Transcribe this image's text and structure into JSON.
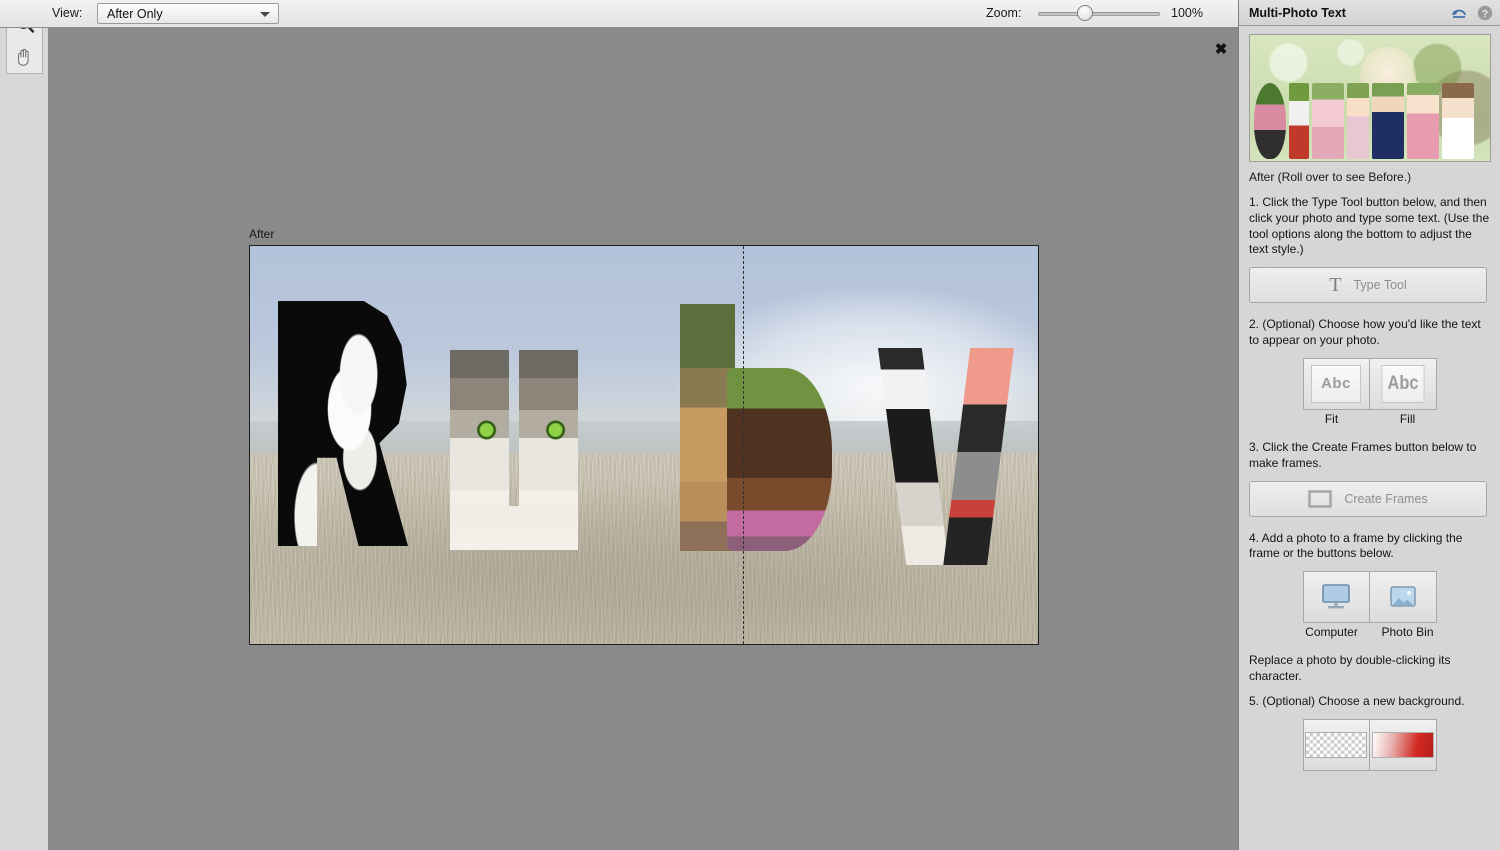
{
  "toolbar": {
    "view_label": "View:",
    "view_value": "After Only",
    "zoom_label": "Zoom:",
    "zoom_value": "100%",
    "zoom_percent": 100,
    "tools": [
      {
        "name": "zoom-tool",
        "icon": "magnifier-icon"
      },
      {
        "name": "hand-tool",
        "icon": "hand-icon"
      }
    ]
  },
  "canvas": {
    "after_label": "After",
    "close_label": "✖",
    "text_content": "RUbV",
    "letters": [
      {
        "char": "R",
        "subject": "tuxedo cat"
      },
      {
        "char": "U",
        "subject": "tabby cat"
      },
      {
        "char": "b",
        "subject": "tan and chocolate dogs"
      },
      {
        "char": "V",
        "subject": "black dogs"
      }
    ],
    "background_subject": "sky over dry grass field"
  },
  "panel": {
    "title": "Multi-Photo Text",
    "header_icons": [
      {
        "name": "reset-icon",
        "label": "↩"
      },
      {
        "name": "help-icon",
        "label": "?"
      }
    ],
    "preview_caption": "After (Roll over to see Before.)",
    "preview_text": "OLIVIA",
    "step1": "1. Click the Type Tool button below, and then click your photo and type some text. (Use the tool options along the bottom to adjust the text style.)",
    "type_tool_button": "Type Tool",
    "type_tool_icon": "T",
    "step2": "2. (Optional) Choose how you'd like the text to appear on your photo.",
    "fit_label": "Fit",
    "fill_label": "Fill",
    "abc_sample": "Abc",
    "step3": "3. Click the Create Frames button below to make frames.",
    "create_frames_button": "Create Frames",
    "step4": "4. Add a photo to a frame by clicking the frame or the buttons below.",
    "computer_label": "Computer",
    "photo_bin_label": "Photo Bin",
    "replace_note": "Replace a photo by double-clicking its character.",
    "step5": "5. (Optional) Choose a new background.",
    "backgrounds": [
      {
        "name": "transparent-background-swatch"
      },
      {
        "name": "red-gradient-background-swatch",
        "color": "#d22a22"
      }
    ]
  }
}
